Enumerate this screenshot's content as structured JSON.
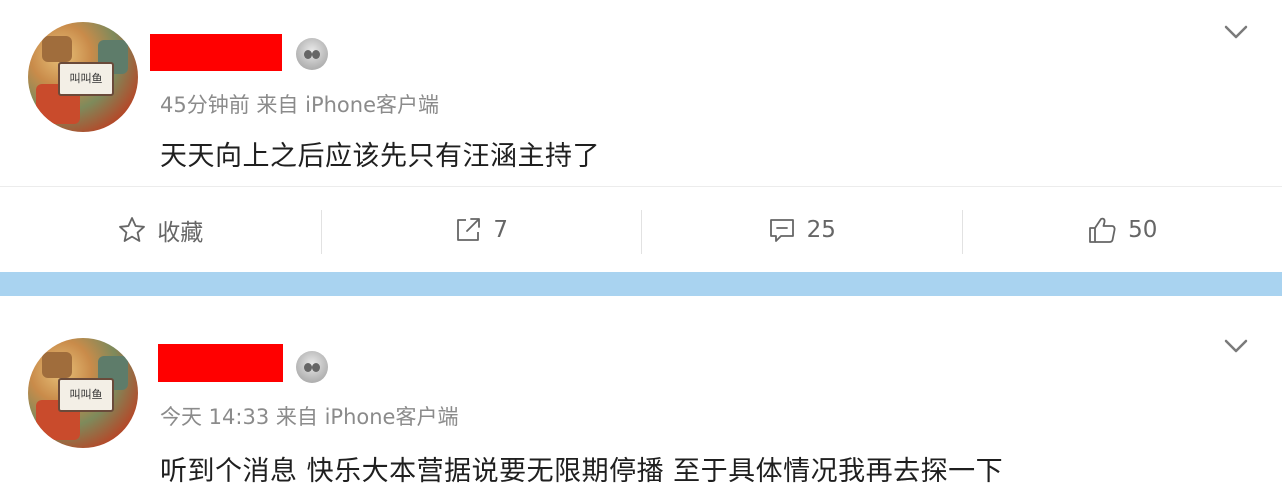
{
  "posts": [
    {
      "time": "45分钟前",
      "source_prefix": "来自",
      "source": "iPhone客户端",
      "content": "天天向上之后应该先只有汪涵主持了",
      "avatar_text": "叫叫鱼",
      "actions": {
        "favorite_label": "收藏",
        "repost_count": "7",
        "comment_count": "25",
        "like_count": "50"
      }
    },
    {
      "time": "今天 14:33",
      "source_prefix": "来自",
      "source": "iPhone客户端",
      "content": "听到个消息 快乐大本营据说要无限期停播 至于具体情况我再去探一下",
      "avatar_text": "叫叫鱼"
    }
  ],
  "icons": {
    "badge": "member-badge-icon",
    "menu": "chevron-down-icon",
    "favorite": "star-icon",
    "repost": "share-icon",
    "comment": "comment-icon",
    "like": "thumbs-up-icon"
  },
  "colors": {
    "redaction": "#ff0000",
    "separator": "#a9d3f0",
    "meta_text": "#8b8b8b"
  }
}
